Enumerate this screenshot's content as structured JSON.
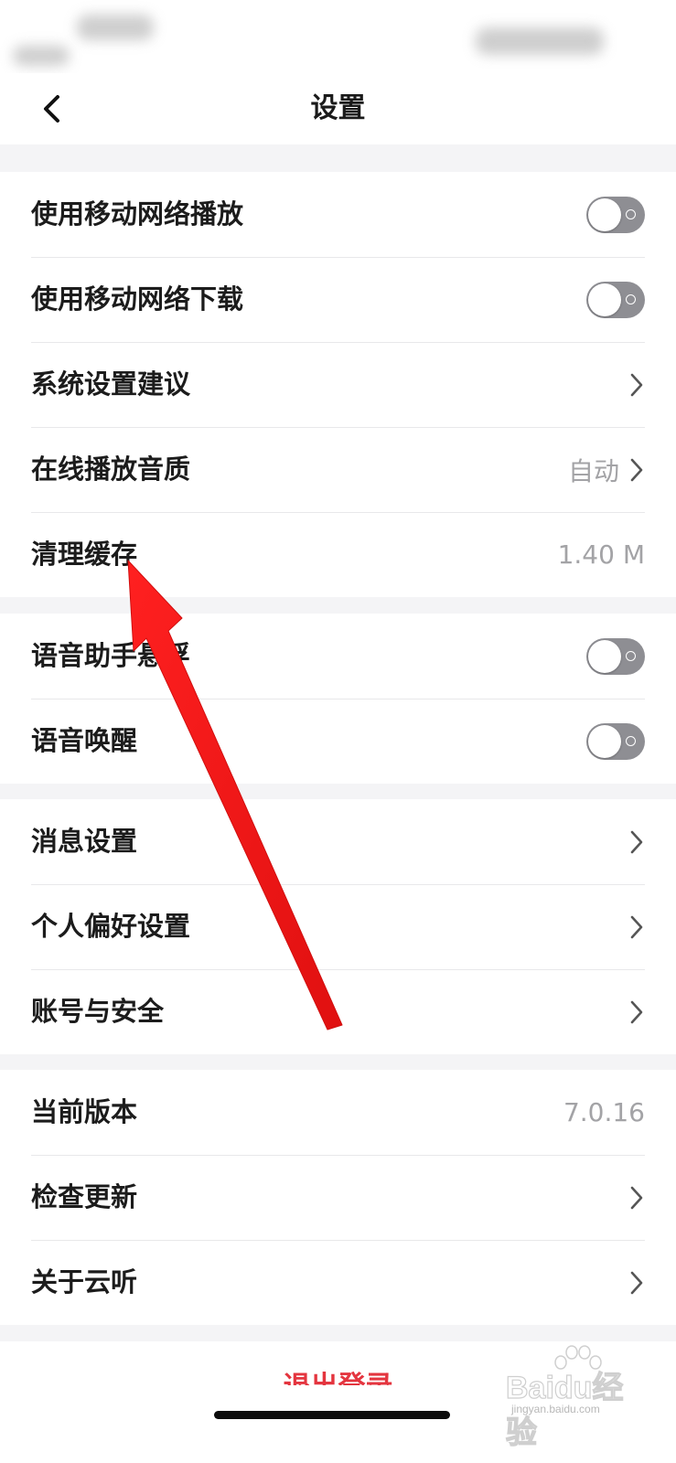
{
  "nav": {
    "title": "设置"
  },
  "sections": [
    {
      "rows": [
        {
          "label": "使用移动网络播放",
          "control": "toggle",
          "toggle_on": false
        },
        {
          "label": "使用移动网络下载",
          "control": "toggle",
          "toggle_on": false
        },
        {
          "label": "系统设置建议",
          "control": "chevron"
        },
        {
          "label": "在线播放音质",
          "control": "chevron",
          "value": "自动"
        },
        {
          "label": "清理缓存",
          "control": "value",
          "value": "1.40 M"
        }
      ]
    },
    {
      "rows": [
        {
          "label": "语音助手悬浮",
          "control": "toggle",
          "toggle_on": false
        },
        {
          "label": "语音唤醒",
          "control": "toggle",
          "toggle_on": false
        }
      ]
    },
    {
      "rows": [
        {
          "label": "消息设置",
          "control": "chevron"
        },
        {
          "label": "个人偏好设置",
          "control": "chevron"
        },
        {
          "label": "账号与安全",
          "control": "chevron"
        }
      ]
    },
    {
      "rows": [
        {
          "label": "当前版本",
          "control": "value",
          "value": "7.0.16"
        },
        {
          "label": "检查更新",
          "control": "chevron"
        },
        {
          "label": "关于云听",
          "control": "chevron"
        }
      ]
    }
  ],
  "logout": {
    "label": "退出登录"
  },
  "watermark": {
    "main": "Baidu经验",
    "sub": "jingyan.baidu.com"
  },
  "colors": {
    "accent_red": "#e4353f",
    "annotation_arrow": "#ee1a1a",
    "toggle_off": "#8e8e93"
  }
}
